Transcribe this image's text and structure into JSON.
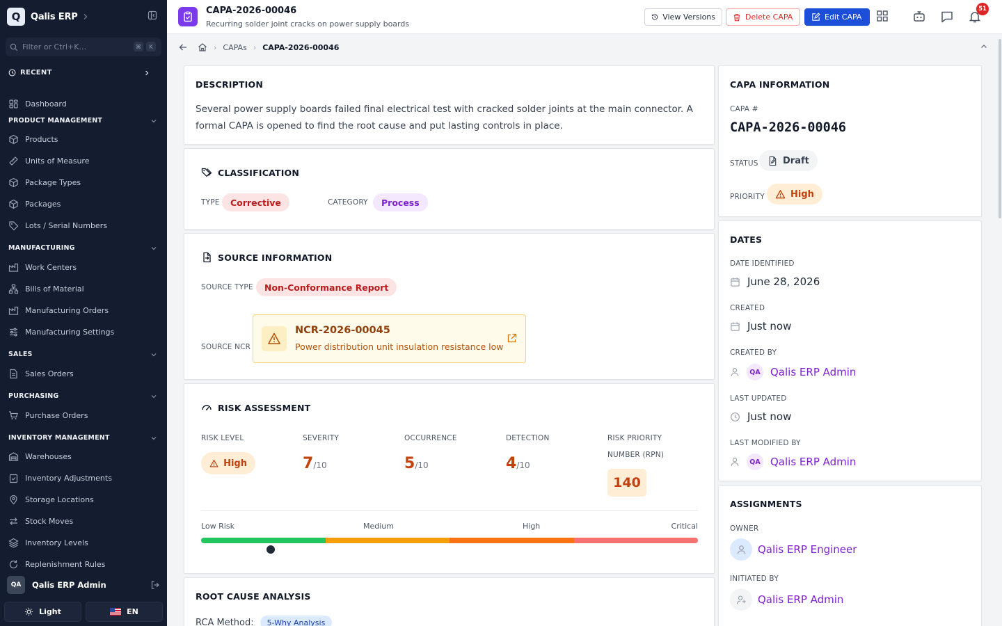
{
  "sidebar": {
    "app_name": "Qalis ERP",
    "logo_letter": "Q",
    "filter_placeholder": "Filter or Ctrl+K...",
    "kbd_cmd": "⌘",
    "kbd_k": "K",
    "recent_label": "RECENT",
    "dashboard": "Dashboard",
    "sections": {
      "product": "PRODUCT MANAGEMENT",
      "manufacturing": "MANUFACTURING",
      "sales": "SALES",
      "purchasing": "PURCHASING",
      "inventory": "INVENTORY MANAGEMENT"
    },
    "items": {
      "products": "Products",
      "uom": "Units of Measure",
      "package_types": "Package Types",
      "packages": "Packages",
      "lots": "Lots / Serial Numbers",
      "work_centers": "Work Centers",
      "bom": "Bills of Material",
      "mo": "Manufacturing Orders",
      "mfg_settings": "Manufacturing Settings",
      "sales_orders": "Sales Orders",
      "purchase_orders": "Purchase Orders",
      "warehouses": "Warehouses",
      "inv_adjust": "Inventory Adjustments",
      "storage": "Storage Locations",
      "stock_moves": "Stock Moves",
      "inv_levels": "Inventory Levels",
      "replenish": "Replenishment Rules"
    },
    "user_initials": "QA",
    "user_name": "Qalis ERP Admin",
    "theme_label": "Light",
    "lang_label": "EN"
  },
  "topbar": {
    "title": "CAPA-2026-00046",
    "subtitle": "Recurring solder joint cracks on power supply boards",
    "view_versions": "View Versions",
    "delete": "Delete CAPA",
    "edit": "Edit CAPA",
    "notif_count": "51"
  },
  "breadcrumb": {
    "parent": "CAPAs",
    "current": "CAPA-2026-00046"
  },
  "description": {
    "title": "DESCRIPTION",
    "text": "Several power supply boards failed final electrical test with cracked solder joints at the main connector. A formal CAPA is opened to find the root cause and put lasting controls in place."
  },
  "classification": {
    "title": "CLASSIFICATION",
    "type_label": "TYPE",
    "type_value": "Corrective",
    "category_label": "CATEGORY",
    "category_value": "Process"
  },
  "source": {
    "title": "SOURCE INFORMATION",
    "type_label": "SOURCE TYPE",
    "type_value": "Non-Conformance Report",
    "ncr_label": "SOURCE NCR",
    "ncr_id": "NCR-2026-00045",
    "ncr_title": "Power distribution unit insulation resistance low"
  },
  "risk": {
    "title": "RISK ASSESSMENT",
    "level_label": "RISK LEVEL",
    "level_value": "High",
    "severity_label": "SEVERITY",
    "severity": "7",
    "occurrence_label": "OCCURRENCE",
    "occurrence": "5",
    "detection_label": "DETECTION",
    "detection": "4",
    "out_of": "/10",
    "rpn_label_1": "RISK PRIORITY",
    "rpn_label_2": "NUMBER (RPN)",
    "rpn": "140",
    "scale": [
      "Low Risk",
      "Medium",
      "High",
      "Critical"
    ],
    "scale_colors": [
      "#22c55e",
      "#f59e0b",
      "#f97316",
      "#f87171"
    ],
    "rpn_scale_position": 0.14
  },
  "rca": {
    "title": "ROOT CAUSE ANALYSIS",
    "method_label": "RCA Method:",
    "method_value": "5-Why Analysis"
  },
  "capa_info": {
    "title": "CAPA INFORMATION",
    "num_label": "CAPA #",
    "num": "CAPA-2026-00046",
    "status_label": "STATUS",
    "status": "Draft",
    "priority_label": "PRIORITY",
    "priority": "High"
  },
  "dates": {
    "title": "DATES",
    "identified_label": "DATE IDENTIFIED",
    "identified": "June 28, 2026",
    "created_label": "CREATED",
    "created": "Just now",
    "created_by_label": "CREATED BY",
    "created_by": "Qalis ERP Admin",
    "updated_label": "LAST UPDATED",
    "updated": "Just now",
    "modified_by_label": "LAST MODIFIED BY",
    "modified_by": "Qalis ERP Admin",
    "initials": "QA"
  },
  "assignments": {
    "title": "ASSIGNMENTS",
    "owner_label": "OWNER",
    "owner": "Qalis ERP Engineer",
    "initiated_label": "INITIATED BY",
    "initiated": "Qalis ERP Admin"
  },
  "colors": {
    "sidebar_bg": "#141c2f",
    "primary": "#1d4ed8",
    "danger": "#dc2626",
    "accent_purple": "#7c3aed",
    "risk_high": "#c2410c"
  }
}
